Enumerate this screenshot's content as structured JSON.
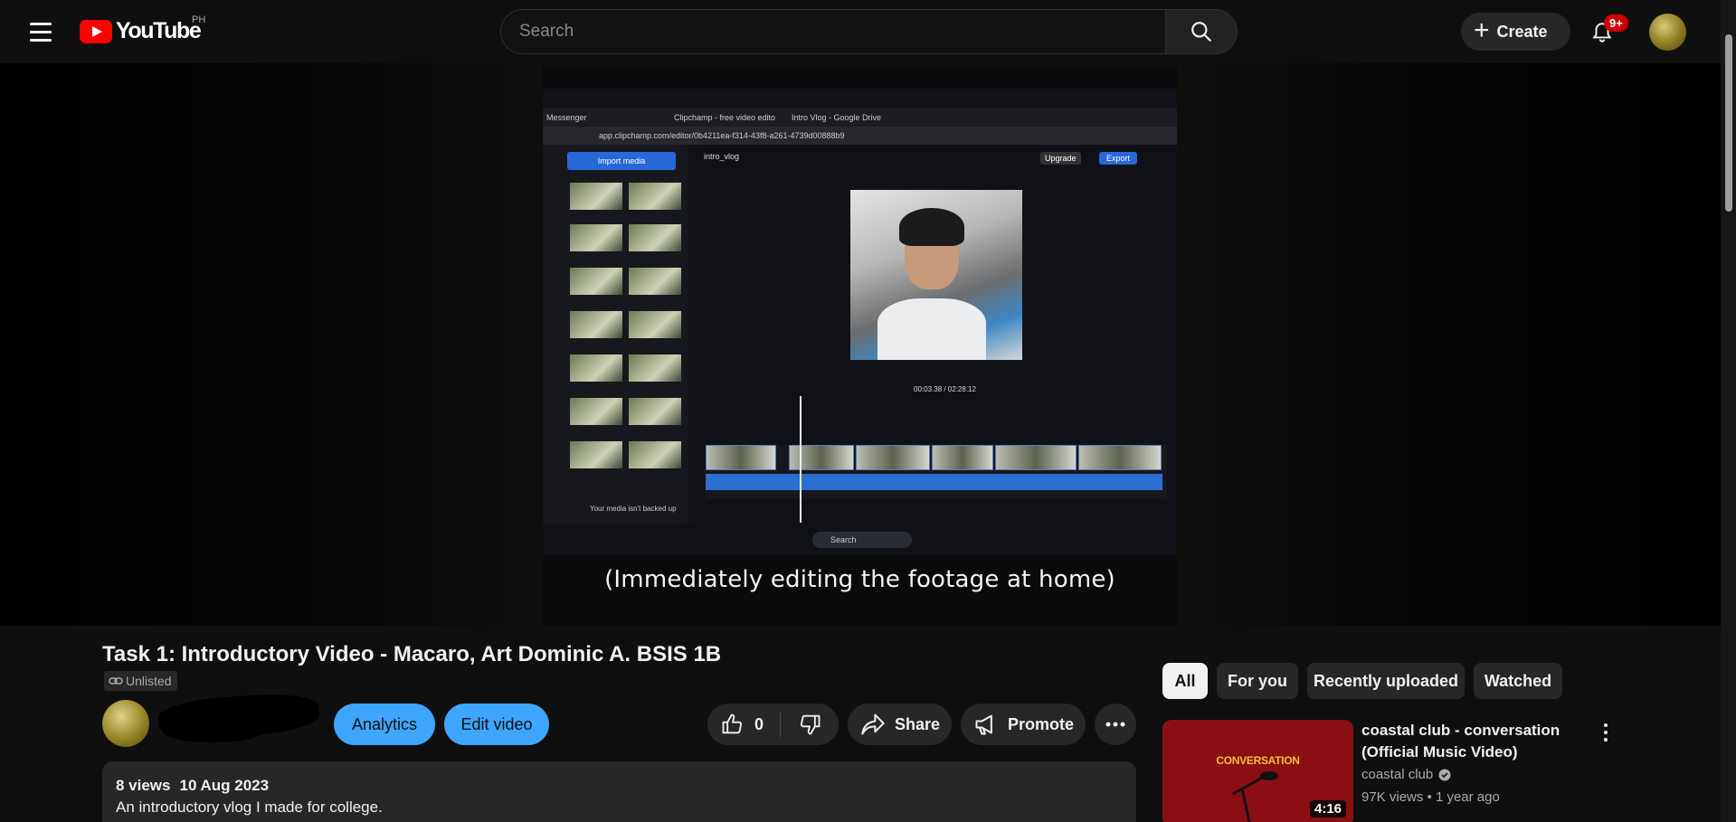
{
  "header": {
    "logo_text": "YouTube",
    "country_code": "PH",
    "search_placeholder": "Search",
    "create_label": "Create",
    "notifications_badge": "9+"
  },
  "player": {
    "caption": "(Immediately editing the footage at home)",
    "screen": {
      "tab_1": "Messenger",
      "tab_2": "Clipchamp - free video edito",
      "tab_3": "Intro Vlog - Google Drive",
      "url": "app.clipchamp.com/editor/0b4211ea-f314-43f8-a261-4739d00888b9",
      "import_label": "Import media",
      "project_name": "intro_vlog",
      "upgrade_label": "Upgrade",
      "export_label": "Export",
      "timecode": "00:03.38 / 02:28.12",
      "taskbar_search": "Search",
      "backup_notice": "Your media isn't backed up"
    }
  },
  "video": {
    "title": "Task 1: Introductory Video - Macaro, Art Dominic A. BSIS 1B",
    "visibility": "Unlisted",
    "analytics_label": "Analytics",
    "edit_label": "Edit video",
    "likes": "0",
    "share_label": "Share",
    "promote_label": "Promote",
    "views": "8 views",
    "date": "10 Aug 2023",
    "description": "An introductory vlog I made for college."
  },
  "chips": [
    "All",
    "For you",
    "Recently uploaded",
    "Watched"
  ],
  "recommendation": {
    "title": "coastal club - conversation (Official Music Video)",
    "channel": "coastal club",
    "meta": "97K views • 1 year ago",
    "duration": "4:16",
    "thumb_text": "CONVERSATION"
  }
}
